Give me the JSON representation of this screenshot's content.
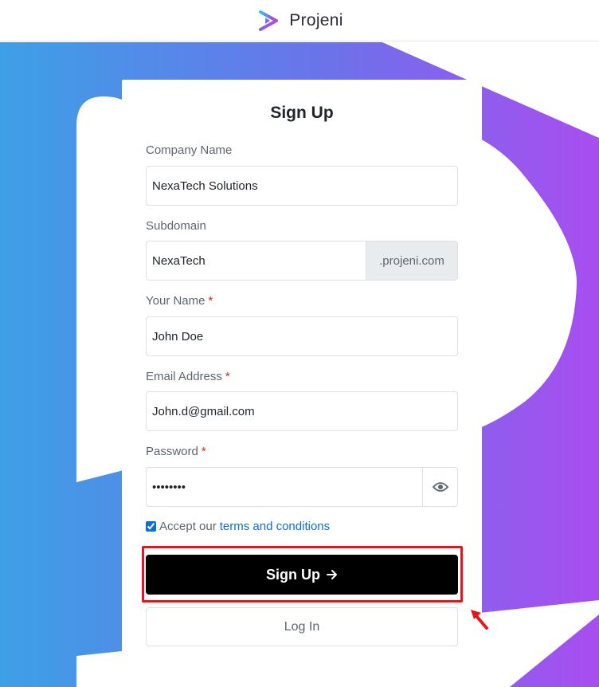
{
  "header": {
    "brand_name": "Projeni",
    "logo_icon": "projeni-play-logo-icon"
  },
  "colors": {
    "brand_blue": "#3da0e6",
    "brand_purple": "#a94df0",
    "link": "#0b6fd4",
    "annotation_red": "#e8141b",
    "button_bg": "#000000"
  },
  "form": {
    "title": "Sign Up",
    "company": {
      "label": "Company Name",
      "value": "NexaTech Solutions"
    },
    "subdomain": {
      "label": "Subdomain",
      "value": "NexaTech",
      "suffix": ".projeni.com"
    },
    "name": {
      "label": "Your Name",
      "required": "*",
      "value": "John Doe"
    },
    "email": {
      "label": "Email Address",
      "required": "*",
      "value": "John.d@gmail.com"
    },
    "password": {
      "label": "Password",
      "required": "*",
      "value": "••••••••",
      "toggle_icon": "eye-icon"
    },
    "accept": {
      "checked": true,
      "text": "Accept our",
      "link": "terms and conditions"
    },
    "submit_label": "Sign Up",
    "submit_icon": "arrow-right-icon",
    "login_label": "Log In"
  },
  "annotation": {
    "icon": "red-pointer-arrow-icon"
  }
}
